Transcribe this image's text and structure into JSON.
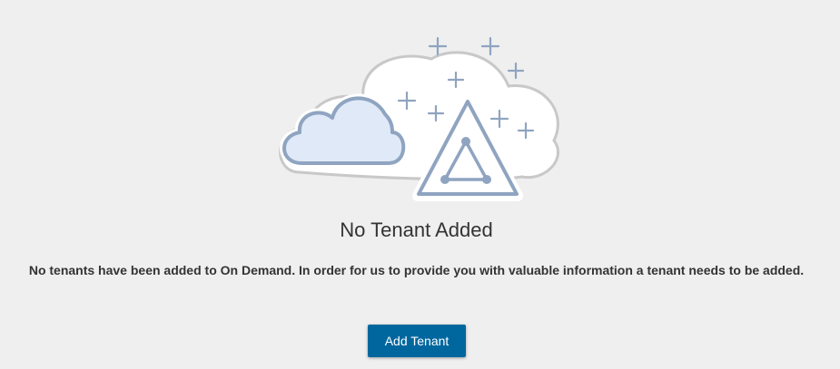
{
  "empty_state": {
    "illustration_icon": "cloud-tenant-illustration",
    "title": "No Tenant Added",
    "description": "No tenants have been added to On Demand. In order for us to provide you with valuable information a tenant needs to be added.",
    "add_button_label": "Add Tenant"
  },
  "colors": {
    "background": "#efefef",
    "accent_button": "#00679e",
    "illustration_stroke": "#8fa4c0",
    "small_cloud_fill": "#dfe9f8",
    "big_cloud_stroke": "#c8c8c8"
  }
}
